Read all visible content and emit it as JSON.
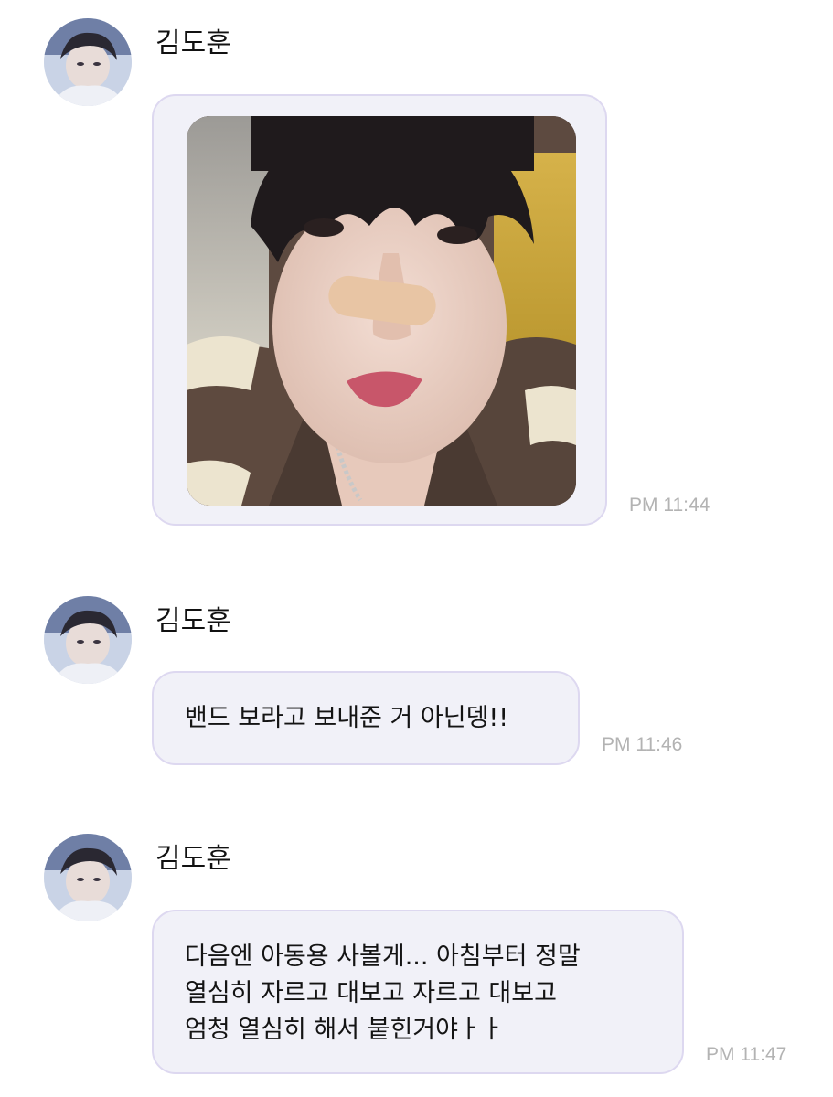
{
  "messages": [
    {
      "sender": "김도훈",
      "type": "image",
      "time": "PM 11:44"
    },
    {
      "sender": "김도훈",
      "type": "text",
      "text": "밴드 보라고 보내준 거 아닌뎅!!",
      "time": "PM 11:46"
    },
    {
      "sender": "김도훈",
      "type": "text",
      "text": "다음엔 아동용 사볼게... 아침부터 정말\n열심히 자르고 대보고 자르고 대보고\n엄청 열심히 해서 붙힌거야ㅏㅏ",
      "time": "PM 11:47"
    }
  ],
  "colors": {
    "bubble_bg": "#f1f1f8",
    "bubble_border": "#ddd8f0",
    "timestamp": "#b3b3b3"
  },
  "icons": {
    "avatar": "profile-photo",
    "photo": "selfie-photo"
  }
}
